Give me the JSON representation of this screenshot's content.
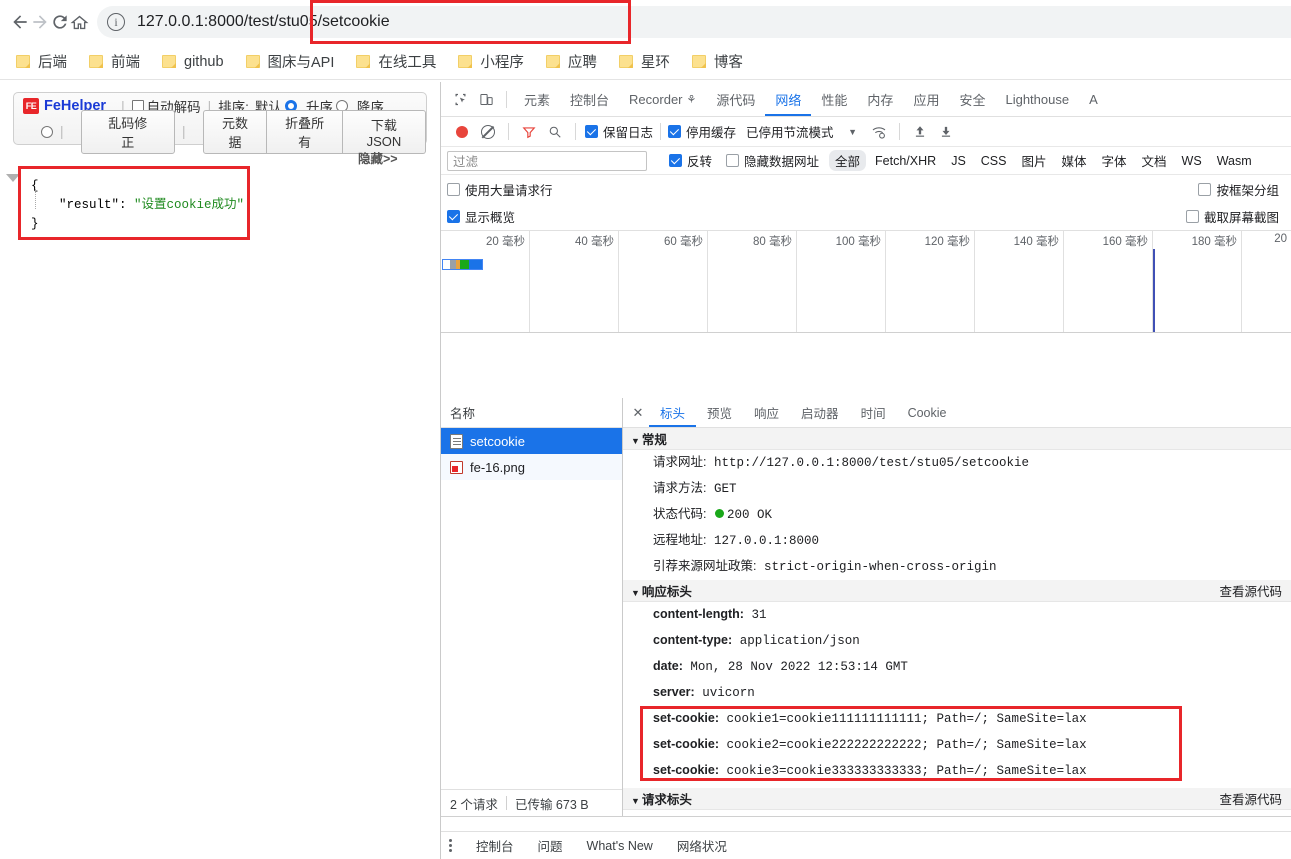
{
  "browser": {
    "nav": {
      "back": "←",
      "forward": "→",
      "reload": "C",
      "home": "⌂"
    },
    "url": "127.0.0.1:8000/test/stu05/setcookie",
    "bookmarks": [
      {
        "label": "后端"
      },
      {
        "label": "前端"
      },
      {
        "label": "github"
      },
      {
        "label": "图床与API"
      },
      {
        "label": "在线工具"
      },
      {
        "label": "小程序"
      },
      {
        "label": "应聘"
      },
      {
        "label": "星环"
      },
      {
        "label": "博客"
      }
    ]
  },
  "fehelper": {
    "logo_text": "FE",
    "name": "FeHelper",
    "auto_decode_label": "自动解码",
    "sort_label": "排序:",
    "sort_default": "默认",
    "sort_asc": "升序",
    "sort_desc": "降序",
    "fix_garbled": "乱码修正",
    "metadata": "元数据",
    "collapse_all": "折叠所有",
    "download_json": "下载JSON",
    "hide": "隐藏>>",
    "json": {
      "open_brace": "{",
      "close_brace": "}",
      "key": "\"result\":",
      "value": "\"设置cookie成功\""
    }
  },
  "devtools": {
    "panel_tabs": [
      {
        "label": "元素",
        "active": false
      },
      {
        "label": "控制台",
        "active": false
      },
      {
        "label": "Recorder",
        "active": false
      },
      {
        "label": "源代码",
        "active": false
      },
      {
        "label": "网络",
        "active": true
      },
      {
        "label": "性能",
        "active": false
      },
      {
        "label": "内存",
        "active": false
      },
      {
        "label": "应用",
        "active": false
      },
      {
        "label": "安全",
        "active": false
      },
      {
        "label": "Lighthouse",
        "active": false
      },
      {
        "label": "A",
        "active": false
      }
    ],
    "toolbar": {
      "preserve_log": "保留日志",
      "preserve_log_checked": true,
      "disable_cache": "停用缓存",
      "disable_cache_checked": true,
      "throttling": "已停用节流模式"
    },
    "filterbar": {
      "filter_placeholder": "过滤",
      "invert": "反转",
      "invert_checked": true,
      "hide_data_urls": "隐藏数据网址",
      "hide_data_urls_checked": false,
      "types": [
        "全部",
        "Fetch/XHR",
        "JS",
        "CSS",
        "图片",
        "媒体",
        "字体",
        "文档",
        "WS",
        "Wasm"
      ],
      "selected_type": "全部"
    },
    "options": {
      "big_request_rows": "使用大量请求行",
      "big_request_rows_checked": false,
      "group_by_frame": "按框架分组",
      "group_by_frame_checked": false,
      "show_overview": "显示概览",
      "show_overview_checked": true,
      "capture_screenshots": "截取屏幕截图",
      "capture_screenshots_checked": false
    },
    "overview": {
      "ticks": [
        "20 毫秒",
        "40 毫秒",
        "60 毫秒",
        "80 毫秒",
        "100 毫秒",
        "120 毫秒",
        "140 毫秒",
        "160 毫秒",
        "180 毫秒",
        "20"
      ],
      "marker_ms": 160
    },
    "requests": {
      "column_name": "名称",
      "rows": [
        {
          "name": "setcookie",
          "icon": "document-icon",
          "selected": true
        },
        {
          "name": "fe-16.png",
          "icon": "image-icon",
          "selected": false
        }
      ],
      "footer_requests": "2 个请求",
      "footer_transferred": "已传输 673 B"
    },
    "detail": {
      "tabs": [
        {
          "label": "标头",
          "active": true
        },
        {
          "label": "预览",
          "active": false
        },
        {
          "label": "响应",
          "active": false
        },
        {
          "label": "启动器",
          "active": false
        },
        {
          "label": "时间",
          "active": false
        },
        {
          "label": "Cookie",
          "active": false
        }
      ],
      "general": {
        "title": "常规",
        "rows": [
          {
            "label": "请求网址:",
            "value": "http://127.0.0.1:8000/test/stu05/setcookie"
          },
          {
            "label": "请求方法:",
            "value": "GET"
          },
          {
            "label": "状态代码:",
            "value": "200 OK",
            "status": true
          },
          {
            "label": "远程地址:",
            "value": "127.0.0.1:8000"
          },
          {
            "label": "引荐来源网址政策:",
            "value": "strict-origin-when-cross-origin"
          }
        ]
      },
      "response_headers": {
        "title": "响应标头",
        "view_source": "查看源代码",
        "rows": [
          {
            "label": "content-length:",
            "value": "31"
          },
          {
            "label": "content-type:",
            "value": "application/json"
          },
          {
            "label": "date:",
            "value": "Mon, 28 Nov 2022 12:53:14 GMT"
          },
          {
            "label": "server:",
            "value": "uvicorn"
          },
          {
            "label": "set-cookie:",
            "value": "cookie1=cookie111111111111; Path=/; SameSite=lax"
          },
          {
            "label": "set-cookie:",
            "value": "cookie2=cookie222222222222; Path=/; SameSite=lax"
          },
          {
            "label": "set-cookie:",
            "value": "cookie3=cookie333333333333; Path=/; SameSite=lax"
          }
        ]
      },
      "request_headers": {
        "title": "请求标头",
        "view_source": "查看源代码"
      }
    },
    "drawer_tabs": [
      {
        "label": "控制台"
      },
      {
        "label": "问题"
      },
      {
        "label": "What's New"
      },
      {
        "label": "网络状况"
      }
    ]
  },
  "colors": {
    "accent": "#1a73e8",
    "highlight": "#e8262a",
    "status_ok": "#1aa81a",
    "json_string": "#1f8a1f"
  }
}
